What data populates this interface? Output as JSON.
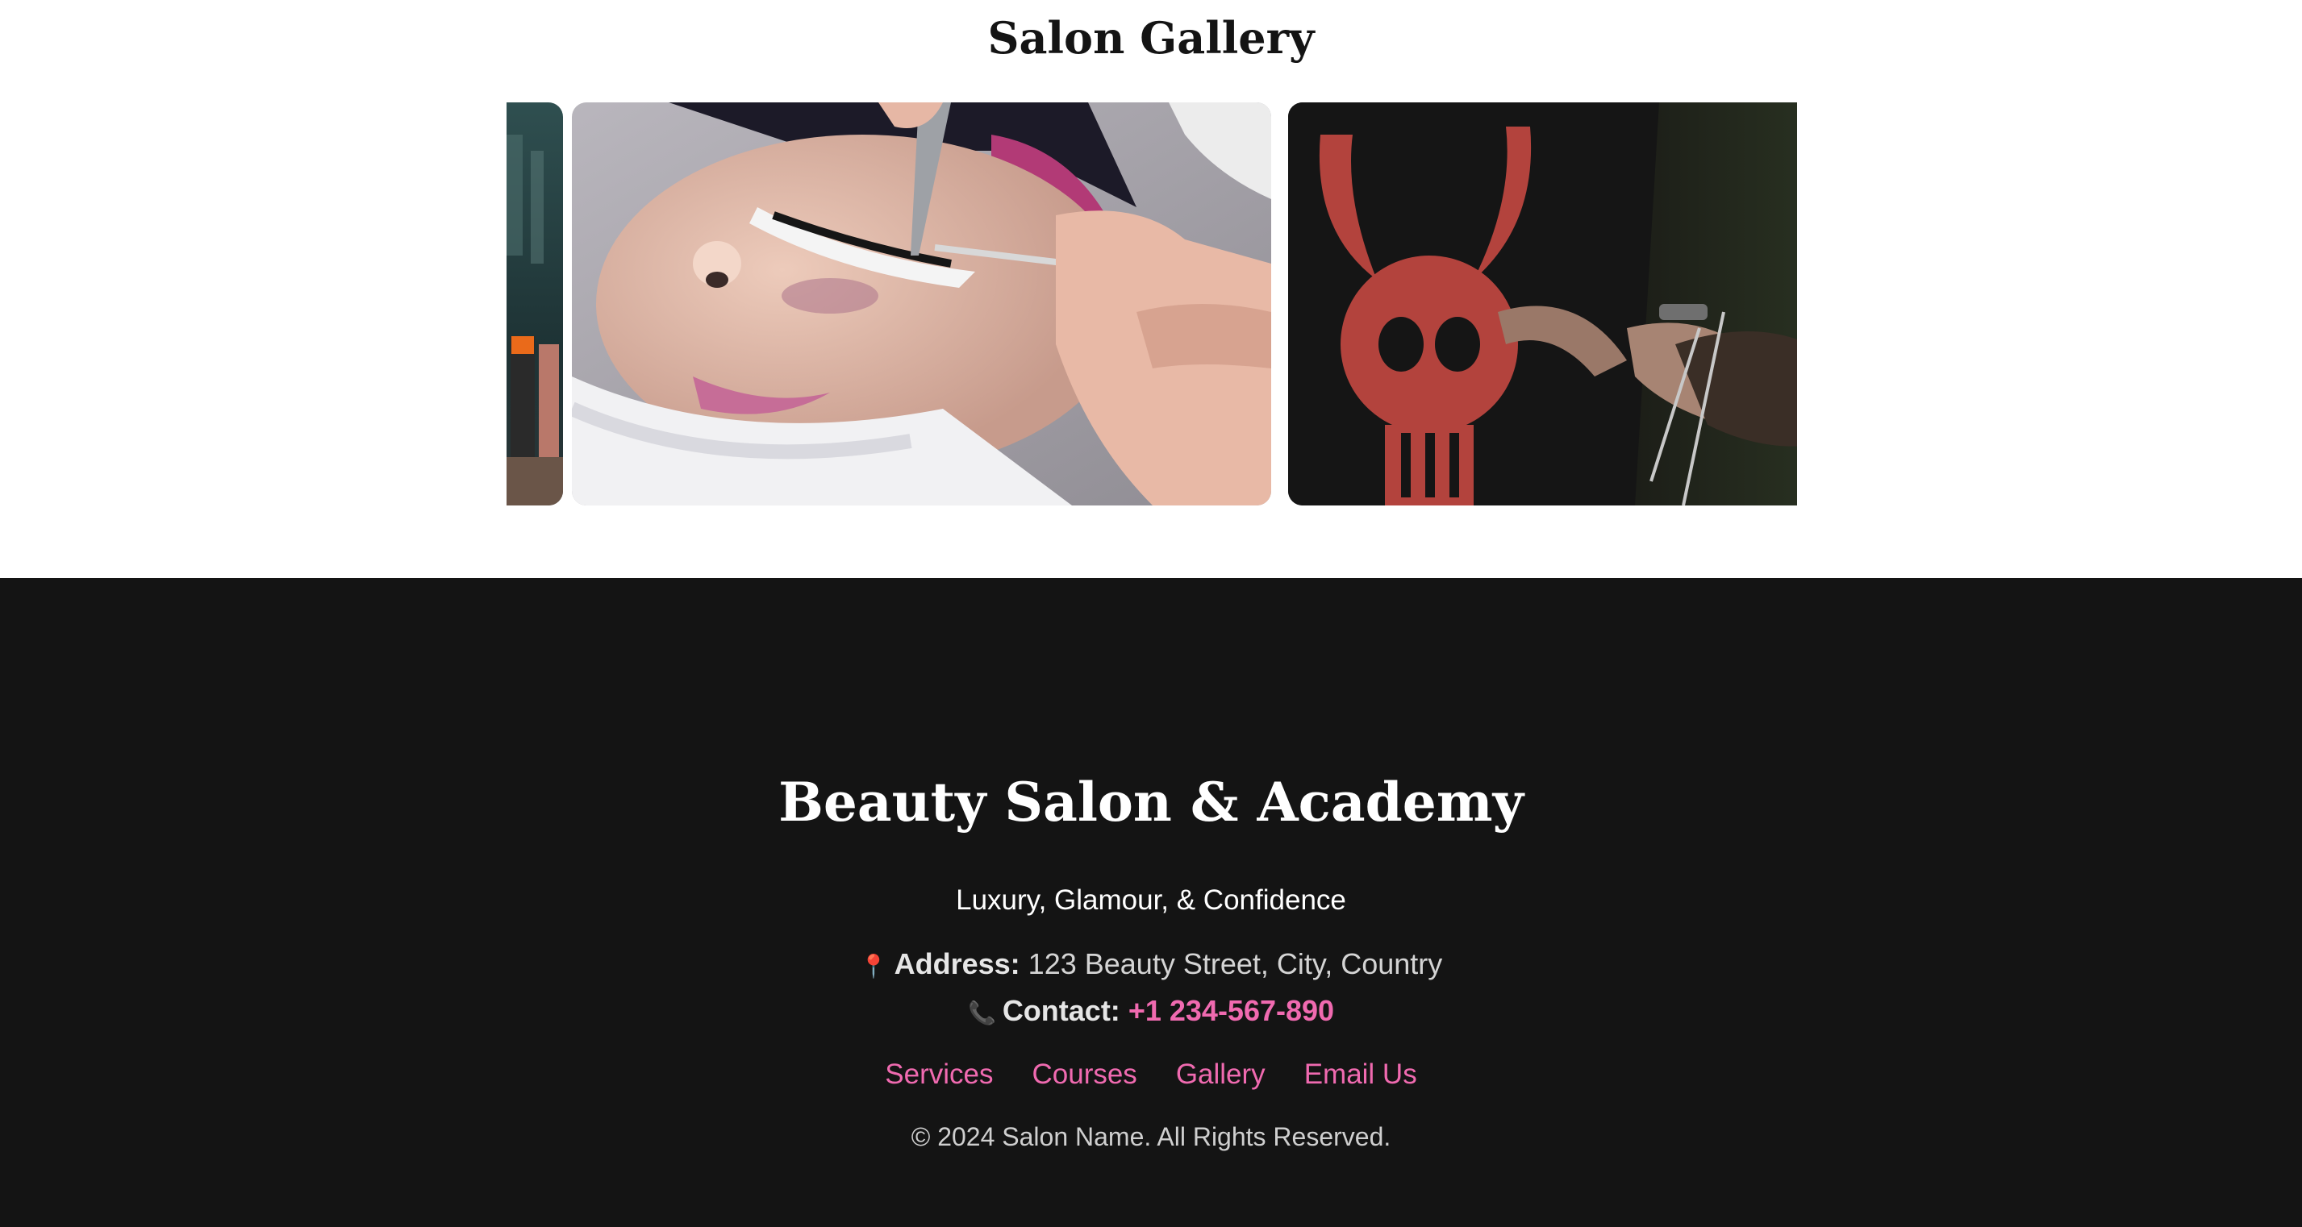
{
  "gallery": {
    "title": "Salon Gallery",
    "slides": [
      {
        "name": "makeup-products"
      },
      {
        "name": "eyelash-extension"
      },
      {
        "name": "barber-haircut"
      }
    ]
  },
  "footer": {
    "brand": "Beauty Salon & Academy",
    "tagline": "Luxury, Glamour, & Confidence",
    "address_icon": "pin-icon",
    "address_label": "Address:",
    "address_value": "123 Beauty Street, City, Country",
    "contact_icon": "phone-icon",
    "contact_label": "Contact:",
    "contact_value": "+1 234-567-890",
    "nav": [
      "Services",
      "Courses",
      "Gallery",
      "Email Us"
    ],
    "copyright": "© 2024 Salon Name. All Rights Reserved."
  },
  "colors": {
    "footer_bg": "#141414",
    "accent_pink": "#f06ab0",
    "page_bg": "#ffffff"
  }
}
